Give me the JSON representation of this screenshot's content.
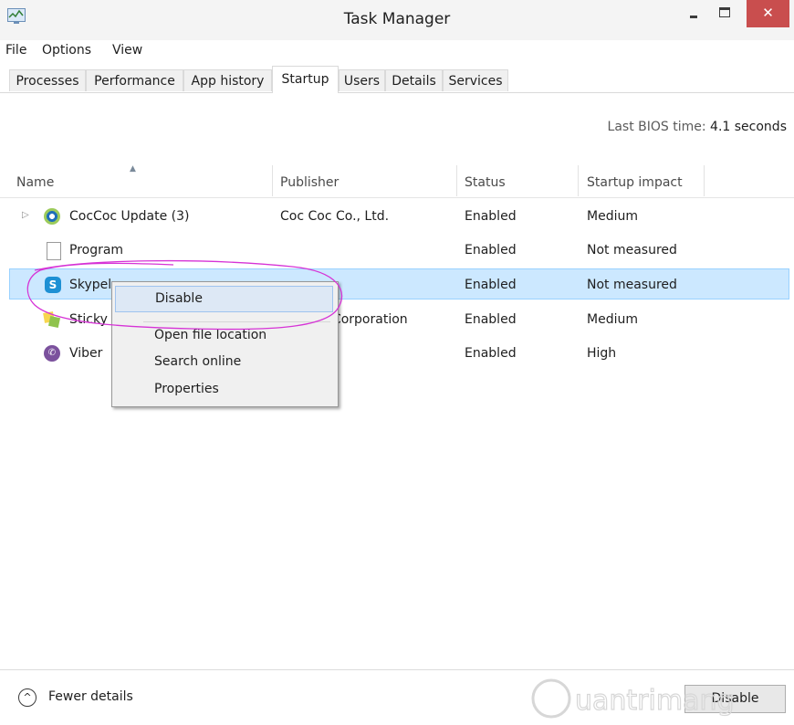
{
  "window": {
    "title": "Task Manager",
    "close_symbol": "✕"
  },
  "menu": [
    "File",
    "Options",
    "View"
  ],
  "tabs": [
    "Processes",
    "Performance",
    "App history",
    "Startup",
    "Users",
    "Details",
    "Services"
  ],
  "active_tab": "Startup",
  "bios": {
    "label": "Last BIOS time:",
    "value": "4.1 seconds"
  },
  "columns": [
    "Name",
    "Publisher",
    "Status",
    "Startup impact"
  ],
  "rows": [
    {
      "icon": "coccoc-icon",
      "name": "CocCoc Update (3)",
      "publisher": "Coc Coc Co., Ltd.",
      "status": "Enabled",
      "impact": "Medium",
      "expandable": true
    },
    {
      "icon": "file-icon",
      "name": "Program",
      "publisher": "",
      "status": "Enabled",
      "impact": "Not measured"
    },
    {
      "icon": "skype-icon",
      "name": "Skypel",
      "publisher": "",
      "status": "Enabled",
      "impact": "Not measured",
      "selected": true
    },
    {
      "icon": "sticky-notes-icon",
      "name": "Sticky",
      "publisher": "t Corporation",
      "status": "Enabled",
      "impact": "Medium"
    },
    {
      "icon": "viber-icon",
      "name": "Viber",
      "publisher": "",
      "status": "Enabled",
      "impact": "High"
    }
  ],
  "context_menu": [
    "Disable",
    "Open file location",
    "Search online",
    "Properties"
  ],
  "context_menu_highlighted": "Disable",
  "annotation_color": "#d633d6",
  "footer": {
    "fewer_details": "Fewer details",
    "disable_button": "Disable"
  },
  "watermark": "uantrimang"
}
